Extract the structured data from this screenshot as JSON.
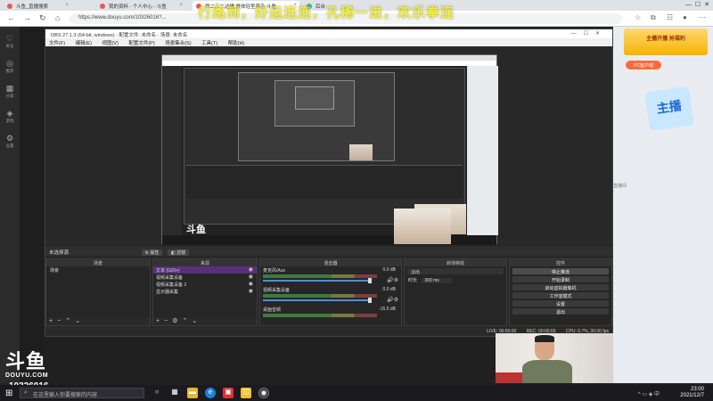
{
  "browser": {
    "tabs": [
      {
        "label": "斗鱼_直播搜索"
      },
      {
        "label": "我的资料 - 个人中心 - 斗鱼"
      },
      {
        "label": "西二三二边播 美体轻型养杂 斗鱼"
      },
      {
        "label": "后台"
      }
    ],
    "url": "https://www.douyu.com/10326016?..."
  },
  "banner": "行路到，好运连连，孔稀一进，欢乐拳连",
  "left_sidebar": [
    "关注",
    "推荐",
    "分类",
    "游戏",
    "设置"
  ],
  "obs": {
    "title": "OBS 27.1.3 (64-bit, windows) - 配置文件: 未命名 - 场景: 未命名",
    "menu": [
      "文件(F)",
      "编辑(E)",
      "视图(V)",
      "配置文件(P)",
      "场景集合(S)",
      "工具(T)",
      "帮助(H)"
    ],
    "not_selected": "未选择源",
    "props_btn": "属性",
    "filters_btn": "滤镜",
    "docks": {
      "scenes": {
        "title": "场景",
        "items": [
          "场景"
        ]
      },
      "sources": {
        "title": "来源",
        "items": [
          "文本 (GDI+)",
          "视频采集设备",
          "视频采集设备 2",
          "显示器采集"
        ]
      },
      "mixer": {
        "title": "混音器",
        "channels": [
          {
            "name": "麦克风/Aux",
            "db": "0.0 dB"
          },
          {
            "name": "视频采集设备",
            "db": "0.0 dB"
          },
          {
            "name": "桌面音频",
            "db": "-15.5 dB"
          }
        ]
      },
      "transitions": {
        "title": "转场特效",
        "type": "淡出",
        "duration_label": "时长",
        "duration": "300 ms"
      },
      "controls": {
        "title": "控件",
        "buttons": [
          "停止推流",
          "开始录制",
          "启动虚拟摄像机",
          "工作室模式",
          "设置",
          "退出"
        ]
      }
    },
    "status": {
      "live": "LIVE: 00:00:00",
      "rec": "REC: 00:00:00",
      "cpu": "CPU: 0.7%, 30.00 fps"
    }
  },
  "right_page": {
    "promo": "主播开播 抢福利",
    "pc_btn": "PC客户端",
    "sticker": "主播",
    "side_text": "直播间"
  },
  "douyu_logo": {
    "big": "斗鱼",
    "small": "DOUYU.COM"
  },
  "room_id": "10326016",
  "taskbar": {
    "search_placeholder": "在这里输入你要搜索的内容",
    "time": "23:00",
    "date": "2021/12/7"
  }
}
